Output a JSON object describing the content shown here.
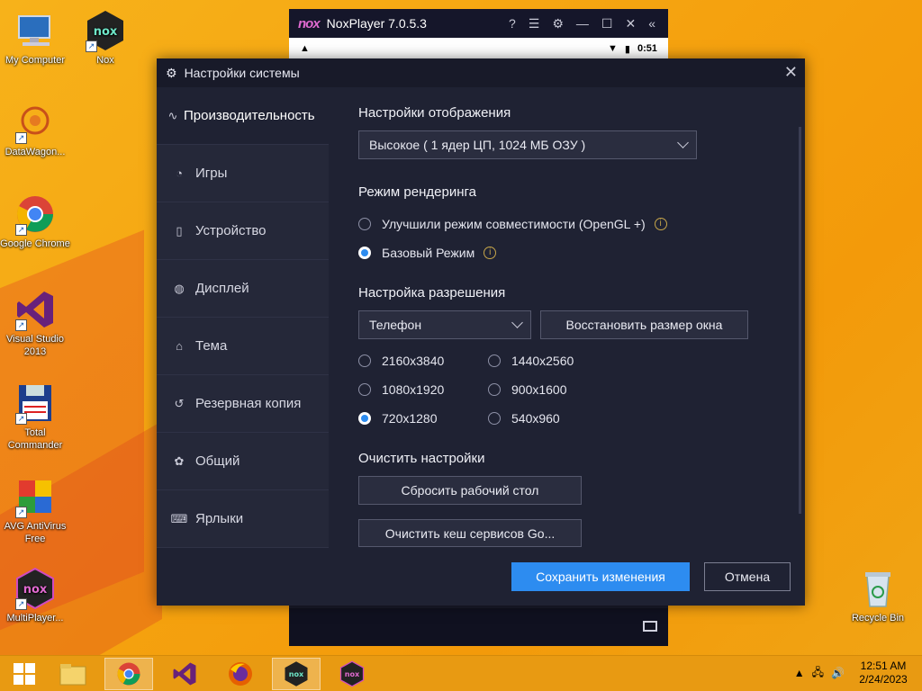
{
  "desktop": {
    "icons": [
      {
        "label": "My Computer"
      },
      {
        "label": "Nox"
      },
      {
        "label": "DataWagon..."
      },
      {
        "label": "Google Chrome"
      },
      {
        "label": "Visual Studio 2013"
      },
      {
        "label": "Total Commander"
      },
      {
        "label": "AVG AntiVirus Free"
      },
      {
        "label": "MultiPlayer..."
      },
      {
        "label": "Recycle Bin"
      }
    ]
  },
  "nox": {
    "logo": "nox",
    "title": "NoxPlayer 7.0.5.3",
    "status_time": "0:51"
  },
  "dialog": {
    "title": "Настройки системы",
    "sidebar": [
      {
        "label": "Производительность",
        "icon": "performance-icon"
      },
      {
        "label": "Игры",
        "icon": "games-icon"
      },
      {
        "label": "Устройство",
        "icon": "device-icon"
      },
      {
        "label": "Дисплей",
        "icon": "display-icon"
      },
      {
        "label": "Тема",
        "icon": "theme-icon"
      },
      {
        "label": "Резервная копия",
        "icon": "backup-icon"
      },
      {
        "label": "Общий",
        "icon": "general-icon"
      },
      {
        "label": "Ярлыки",
        "icon": "shortcuts-icon"
      }
    ],
    "display_settings": {
      "heading": "Настройки отображения",
      "selected": "Высокое ( 1 ядер ЦП, 1024 МБ ОЗУ )"
    },
    "render_mode": {
      "heading": "Режим рендеринга",
      "options": [
        {
          "label": "Улучшили режим совместимости (OpenGL +)",
          "checked": false
        },
        {
          "label": "Базовый Режим",
          "checked": true
        }
      ]
    },
    "resolution": {
      "heading": "Настройка разрешения",
      "device": "Телефон",
      "restore_button": "Восстановить размер окна",
      "options": [
        {
          "label": "2160x3840",
          "checked": false
        },
        {
          "label": "1440x2560",
          "checked": false
        },
        {
          "label": "1080x1920",
          "checked": false
        },
        {
          "label": "900x1600",
          "checked": false
        },
        {
          "label": "720x1280",
          "checked": true
        },
        {
          "label": "540x960",
          "checked": false
        }
      ]
    },
    "clear": {
      "heading": "Очистить настройки",
      "reset_desktop": "Сбросить рабочий стол",
      "clear_cache": "Очистить кеш сервисов Go..."
    },
    "save_button": "Сохранить изменения",
    "cancel_button": "Отмена"
  },
  "taskbar": {
    "time": "12:51 AM",
    "date": "2/24/2023"
  },
  "colors": {
    "accent": "#2d8cf0",
    "dialog_bg": "#1f2233",
    "sidebar_bg": "#252839"
  }
}
